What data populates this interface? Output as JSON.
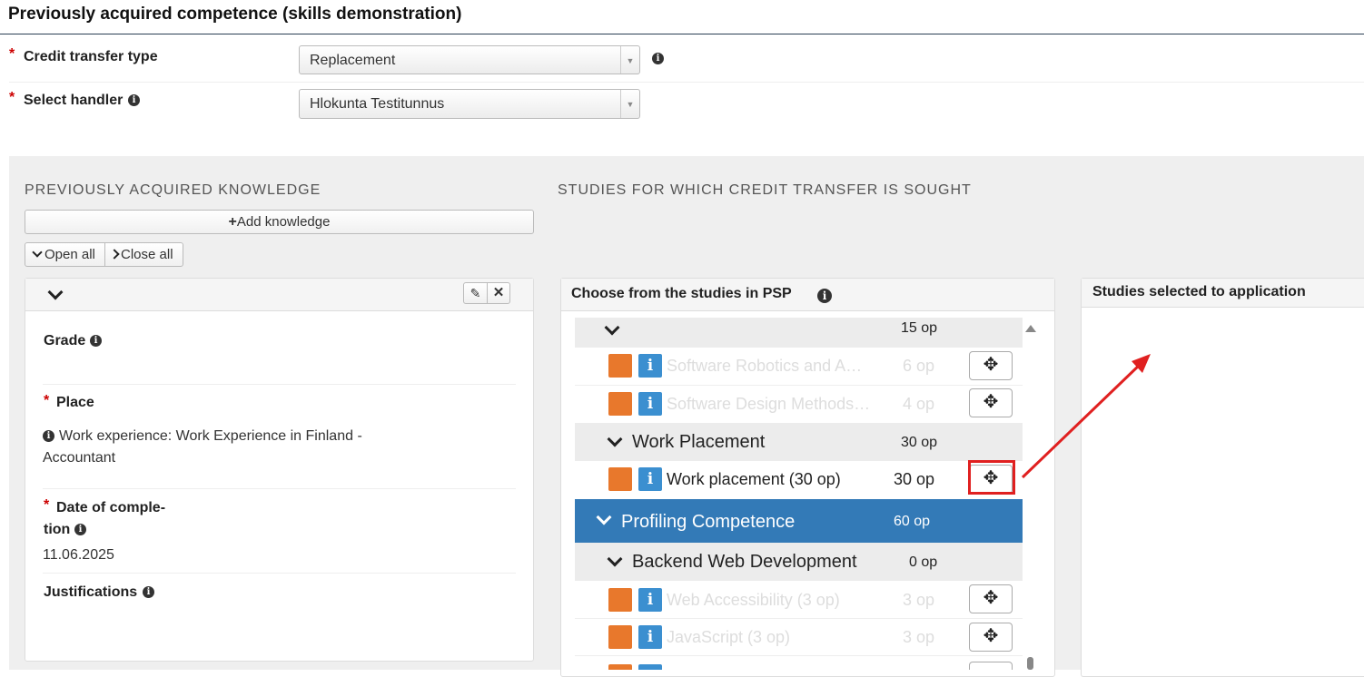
{
  "page": {
    "title": "Previously acquired competence (skills demonstration)"
  },
  "form": {
    "required_mark": "*",
    "credit_type": {
      "label": "Credit transfer type",
      "value": "Replacement"
    },
    "handler": {
      "label": "Select handler",
      "value": "Hlokunta Testitunnus"
    }
  },
  "left": {
    "heading": "PREVIOUSLY ACQUIRED KNOWLEDGE",
    "add_label": "Add knowledge",
    "open_all": "Open all",
    "close_all": "Close all",
    "grade_label": "Grade",
    "place_label": "Place",
    "place_value_line1": "Work experience: Work Experience in Finland -",
    "place_value_line2": "Accountant",
    "date_label_line1": "Date of comple-",
    "date_label_line2": "tion",
    "date_value": "11.06.2025",
    "justifications_label": "Justifications"
  },
  "middle": {
    "heading": "STUDIES FOR WHICH CREDIT TRANSFER IS SOUGHT",
    "panel_title": "Choose from the studies in PSP",
    "rows": [
      {
        "name": "",
        "credits": "15 op"
      },
      {
        "name": "Software Robotics and A…",
        "credits": "6 op"
      },
      {
        "name": "Software Design Methods…",
        "credits": "4 op"
      },
      {
        "name": "Work Placement",
        "credits": "30 op"
      },
      {
        "name": "Work placement (30 op)",
        "credits": "30 op"
      },
      {
        "name": "Profiling Competence",
        "credits": "60 op"
      },
      {
        "name": "Backend Web Development",
        "credits": "0 op"
      },
      {
        "name": "Web Accessibility (3 op)",
        "credits": "3 op"
      },
      {
        "name": "JavaScript (3 op)",
        "credits": "3 op"
      }
    ]
  },
  "right": {
    "panel_title": "Studies selected to application"
  },
  "colors": {
    "accent": "#337ab7",
    "orange": "#e8782c",
    "info_blue": "#3b8fd0",
    "highlight_red": "#e02020"
  }
}
